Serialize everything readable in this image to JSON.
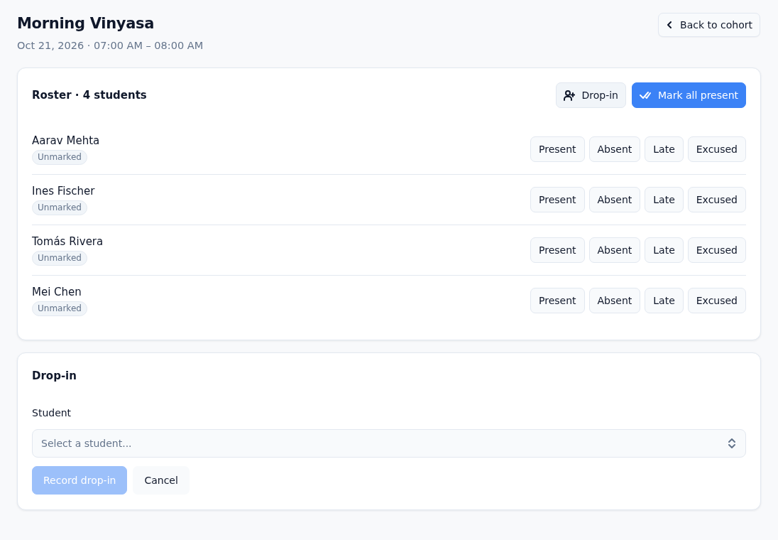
{
  "header": {
    "title": "Morning Vinyasa",
    "subtitle": "Oct 21, 2026 · 07:00 AM – 08:00 AM",
    "back_button": "Back to cohort"
  },
  "roster": {
    "title": "Roster · 4 students",
    "actions": [
      {
        "label": "Drop-in",
        "kind": "secondary"
      },
      {
        "label": "Mark all present",
        "kind": "primary"
      }
    ],
    "students": [
      {
        "name": "Aarav Mehta",
        "status": "Unmarked",
        "options": [
          {
            "label": "Present",
            "selected": false
          },
          {
            "label": "Absent",
            "selected": false
          },
          {
            "label": "Late",
            "selected": false
          },
          {
            "label": "Excused",
            "selected": false
          }
        ]
      },
      {
        "name": "Ines Fischer",
        "status": "Unmarked",
        "options": [
          {
            "label": "Present",
            "selected": false
          },
          {
            "label": "Absent",
            "selected": false
          },
          {
            "label": "Late",
            "selected": false
          },
          {
            "label": "Excused",
            "selected": false
          }
        ]
      },
      {
        "name": "Tomás Rivera",
        "status": "Unmarked",
        "options": [
          {
            "label": "Present",
            "selected": false
          },
          {
            "label": "Absent",
            "selected": false
          },
          {
            "label": "Late",
            "selected": false
          },
          {
            "label": "Excused",
            "selected": false
          }
        ]
      },
      {
        "name": "Mei Chen",
        "status": "Unmarked",
        "options": [
          {
            "label": "Present",
            "selected": false
          },
          {
            "label": "Absent",
            "selected": false
          },
          {
            "label": "Late",
            "selected": false
          },
          {
            "label": "Excused",
            "selected": false
          }
        ]
      }
    ]
  },
  "drop_in": {
    "title": "Drop-in",
    "field_label": "Student",
    "select": {
      "placeholder": "Select a student..."
    },
    "buttons": [
      {
        "label": "Record drop-in",
        "kind": "primary",
        "disabled": true
      },
      {
        "label": "Cancel",
        "kind": "secondary",
        "disabled": false
      }
    ]
  }
}
